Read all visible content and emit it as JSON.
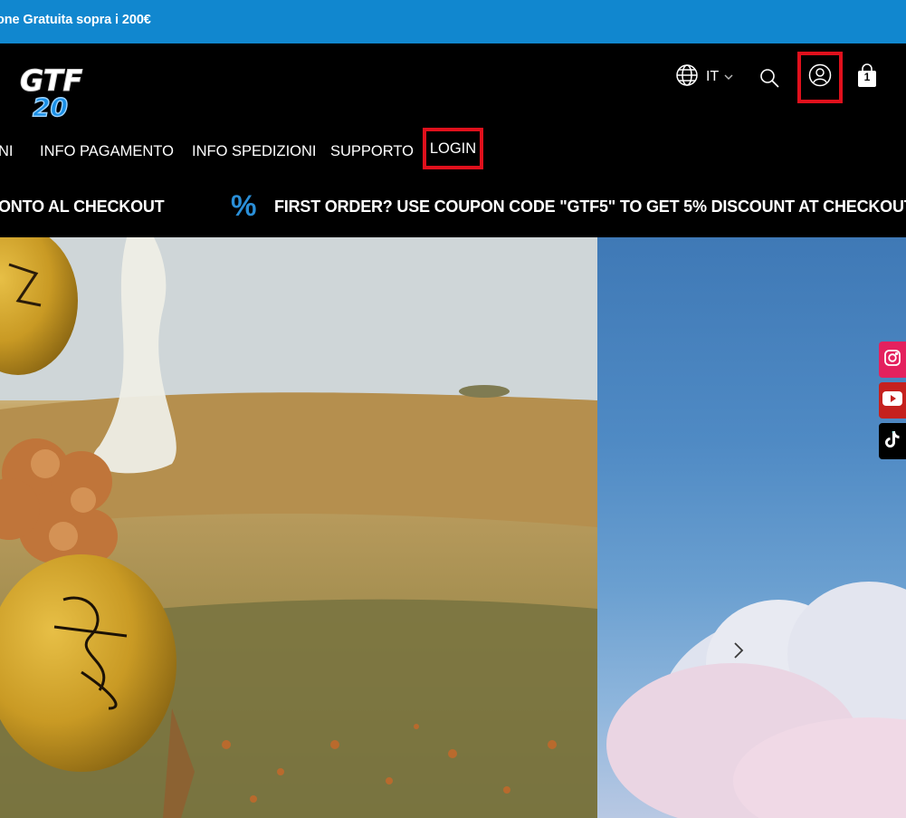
{
  "announcement": {
    "text": "one Gratuita sopra i 200€"
  },
  "header": {
    "logo_text": "GTF",
    "logo_number": "20",
    "language": "IT",
    "cart_count": "1"
  },
  "nav": {
    "items": [
      "NI",
      "INFO PAGAMENTO",
      "INFO SPEDIZIONI",
      "SUPPORTO"
    ],
    "login": "LOGIN"
  },
  "promo": {
    "left_text": "ONTO AL CHECKOUT",
    "right_text": "FIRST ORDER? USE COUPON CODE \"GTF5\" TO GET 5% DISCOUNT AT CHECKOUT",
    "percent_symbol": "%"
  },
  "colors": {
    "announcement_bg": "#1187cf",
    "highlight_border": "#e0101c",
    "instagram": "#e4215e",
    "youtube": "#c5211e",
    "tiktok": "#000000"
  },
  "icons": [
    "globe-icon",
    "chevron-down-icon",
    "search-icon",
    "user-icon",
    "shopping-bag-icon",
    "chevron-right-icon",
    "instagram-icon",
    "youtube-icon",
    "tiktok-icon"
  ]
}
